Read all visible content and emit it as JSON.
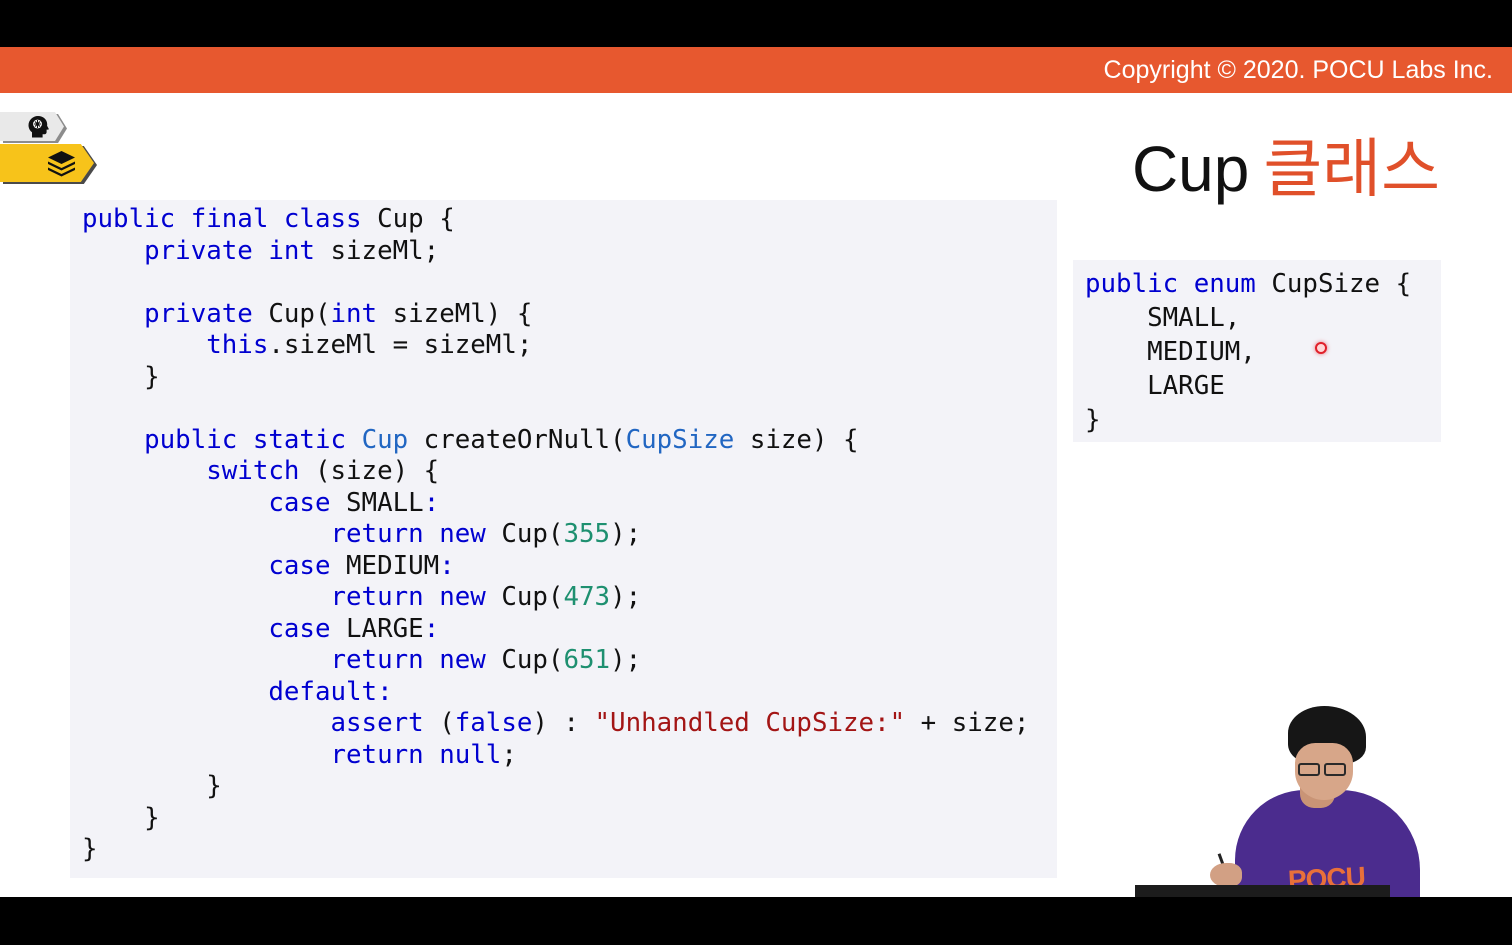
{
  "header": {
    "copyright": "Copyright © 2020. POCU Labs Inc."
  },
  "icons": {
    "concept_tab": "brain-head-icon",
    "resources_tab": "layers-stack-icon"
  },
  "slide": {
    "title_main": "Cup",
    "title_accent": "클래스"
  },
  "colors": {
    "header_bar": "#E7582F",
    "title_accent": "#E0502A",
    "code_background": "#F3F3F8",
    "keyword": "#0000D0",
    "type_name": "#2166C2",
    "number": "#1E9070",
    "string": "#A31515"
  },
  "code_main": {
    "lines": [
      [
        {
          "text": "public final class",
          "color": "#0000D0"
        },
        " Cup {"
      ],
      [
        "    ",
        {
          "text": "private int",
          "color": "#0000D0"
        },
        " sizeMl;"
      ],
      [],
      [
        "    ",
        {
          "text": "private",
          "color": "#0000D0"
        },
        " Cup(",
        {
          "text": "int",
          "color": "#0000D0"
        },
        " sizeMl) {"
      ],
      [
        "        ",
        {
          "text": "this",
          "color": "#0000D0"
        },
        ".sizeMl = sizeMl;"
      ],
      [
        "    }"
      ],
      [],
      [
        "    ",
        {
          "text": "public static",
          "color": "#0000D0"
        },
        " ",
        {
          "text": "Cup",
          "color": "#2166C2"
        },
        " createOrNull(",
        {
          "text": "CupSize",
          "color": "#2166C2"
        },
        " size) {"
      ],
      [
        "        ",
        {
          "text": "switch",
          "color": "#0000D0"
        },
        " (size) {"
      ],
      [
        "            ",
        {
          "text": "case",
          "color": "#0000D0"
        },
        " SMALL",
        {
          "text": ":",
          "color": "#0000D0"
        }
      ],
      [
        "                ",
        {
          "text": "return new",
          "color": "#0000D0"
        },
        " Cup(",
        {
          "text": "355",
          "color": "#1E9070"
        },
        ");"
      ],
      [
        "            ",
        {
          "text": "case",
          "color": "#0000D0"
        },
        " MEDIUM",
        {
          "text": ":",
          "color": "#0000D0"
        }
      ],
      [
        "                ",
        {
          "text": "return new",
          "color": "#0000D0"
        },
        " Cup(",
        {
          "text": "473",
          "color": "#1E9070"
        },
        ");"
      ],
      [
        "            ",
        {
          "text": "case",
          "color": "#0000D0"
        },
        " LARGE",
        {
          "text": ":",
          "color": "#0000D0"
        }
      ],
      [
        "                ",
        {
          "text": "return new",
          "color": "#0000D0"
        },
        " Cup(",
        {
          "text": "651",
          "color": "#1E9070"
        },
        ");"
      ],
      [
        "            ",
        {
          "text": "default:",
          "color": "#0000D0"
        }
      ],
      [
        "                ",
        {
          "text": "assert",
          "color": "#0000D0"
        },
        " (",
        {
          "text": "false",
          "color": "#0000D0"
        },
        ") : ",
        {
          "text": "\"Unhandled CupSize:\"",
          "color": "#A31515"
        },
        " + size;"
      ],
      [
        "                ",
        {
          "text": "return null",
          "color": "#0000D0"
        },
        ";"
      ],
      [
        "        }"
      ],
      [
        "    }"
      ],
      [
        "}"
      ]
    ]
  },
  "code_enum": {
    "lines": [
      [
        {
          "text": "public enum",
          "color": "#0000D0"
        },
        " CupSize {"
      ],
      [
        "    SMALL,"
      ],
      [
        "    MEDIUM,"
      ],
      [
        "    LARGE"
      ],
      [
        "}"
      ]
    ]
  },
  "presenter": {
    "shirt_logo": "POCU"
  }
}
